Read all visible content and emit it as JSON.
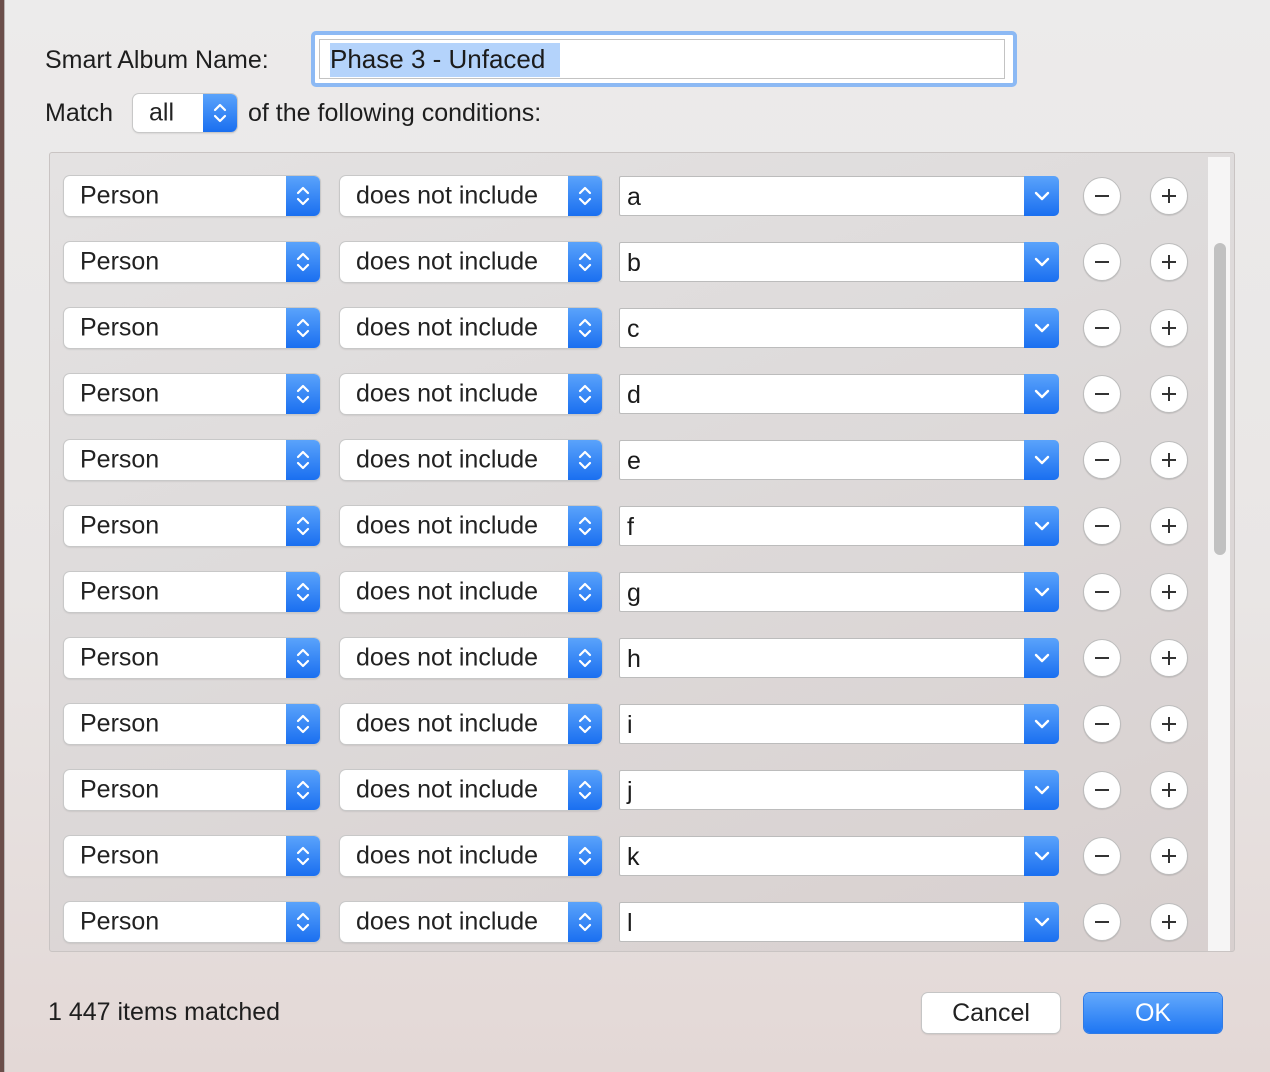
{
  "dialog": {
    "name_label": "Smart Album Name:",
    "name_value": "Phase 3 - Unfaced",
    "match_label": "Match",
    "match_value": "all",
    "conditions_label": "of the following conditions:"
  },
  "rules": [
    {
      "field": "Person",
      "operator": "does not include",
      "value": "a"
    },
    {
      "field": "Person",
      "operator": "does not include",
      "value": "b"
    },
    {
      "field": "Person",
      "operator": "does not include",
      "value": "c"
    },
    {
      "field": "Person",
      "operator": "does not include",
      "value": "d"
    },
    {
      "field": "Person",
      "operator": "does not include",
      "value": "e"
    },
    {
      "field": "Person",
      "operator": "does not include",
      "value": "f"
    },
    {
      "field": "Person",
      "operator": "does not include",
      "value": "g"
    },
    {
      "field": "Person",
      "operator": "does not include",
      "value": "h"
    },
    {
      "field": "Person",
      "operator": "does not include",
      "value": "i"
    },
    {
      "field": "Person",
      "operator": "does not include",
      "value": "j"
    },
    {
      "field": "Person",
      "operator": "does not include",
      "value": "k"
    },
    {
      "field": "Person",
      "operator": "does not include",
      "value": "l"
    }
  ],
  "footer": {
    "matched": "1 447 items matched",
    "cancel_label": "Cancel",
    "ok_label": "OK"
  },
  "icons": {
    "stepper": "up-down-chevron-icon",
    "combo_arrow": "chevron-down-icon",
    "remove": "minus-icon",
    "add": "plus-icon"
  },
  "colors": {
    "accent": "#1a6ff0",
    "focus_ring": "#8cb9f4",
    "selection": "#b4d3fb"
  }
}
